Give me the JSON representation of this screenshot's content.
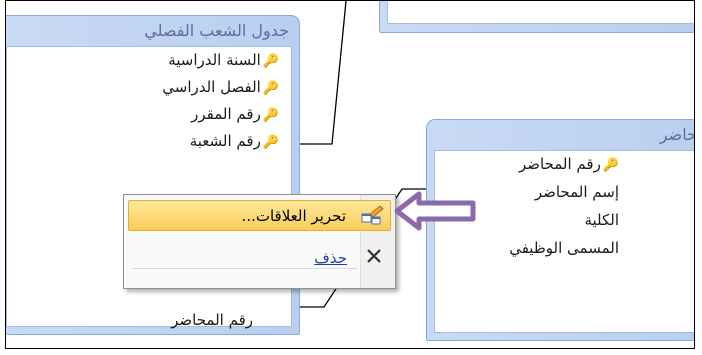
{
  "table_sections": {
    "title": "جدول الشعب الفصلي",
    "fields": [
      {
        "label": "السنة الدراسية",
        "key": true
      },
      {
        "label": "الفصل الدراسي",
        "key": true
      },
      {
        "label": "رقم المقرر",
        "key": true
      },
      {
        "label": "رقم الشعبة",
        "key": true
      },
      {
        "label": "رقم المحاضر",
        "key": false
      }
    ]
  },
  "table_lecturer": {
    "title": "المحاضر",
    "fields": [
      {
        "label": "رقم المحاضر",
        "key": true
      },
      {
        "label": "إسم المحاضر",
        "key": false
      },
      {
        "label": "الكلية",
        "key": false
      },
      {
        "label": "المسمى الوظيفي",
        "key": false
      }
    ]
  },
  "context_menu": {
    "items": [
      {
        "label": "تحرير العلاقات...",
        "icon": "edit-relationships-icon",
        "highlighted": true
      },
      {
        "label": "حذف",
        "icon": "close-x-icon",
        "highlighted": false
      }
    ]
  },
  "colors": {
    "accent_arrow": "#8a6aa8",
    "menu_highlight": "#fbd66b",
    "table_border": "#8aa8d6"
  }
}
